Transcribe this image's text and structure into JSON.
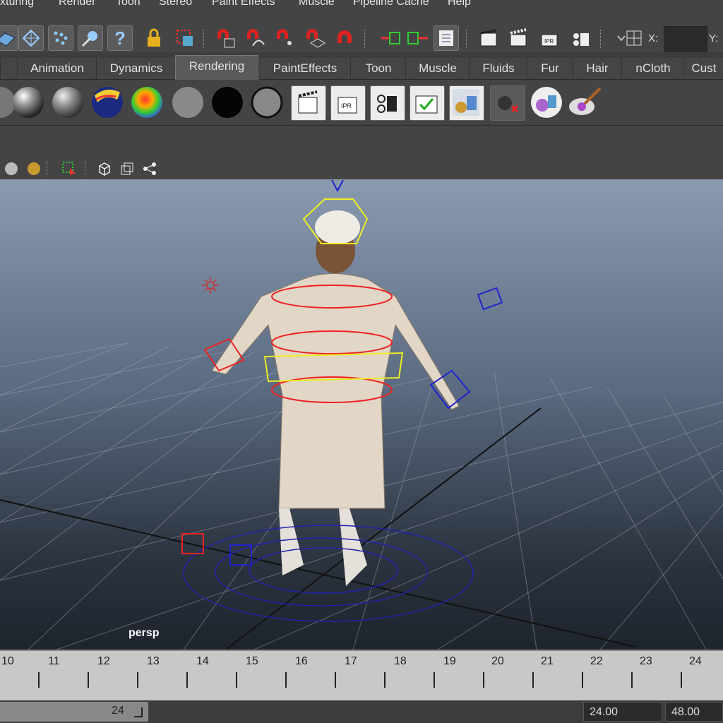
{
  "menus": [
    "xturing",
    "Render",
    "Toon",
    "Stereo",
    "Paint Effects",
    "Muscle",
    "Pipeline Cache",
    "Help"
  ],
  "status": {
    "x_label": "X:",
    "x_value": "",
    "y_label": "Y:",
    "icons": [
      "vertex-mode-icon",
      "mesh-select-icon",
      "particle-icon",
      "magnet-tool-icon",
      "help-icon",
      "lock-icon",
      "select-region-icon",
      "snap-grid-icon",
      "snap-curve-icon",
      "snap-point-icon",
      "snap-plane-icon",
      "snap-live-icon",
      "input-ops-icon",
      "output-ops-icon",
      "attribute-editor-icon",
      "render-view-icon",
      "render-current-icon",
      "ipr-render-icon",
      "render-settings-icon"
    ]
  },
  "shelf_tabs": [
    "",
    "Animation",
    "Dynamics",
    "Rendering",
    "PaintEffects",
    "Toon",
    "Muscle",
    "Fluids",
    "Fur",
    "Hair",
    "nCloth",
    "Cust"
  ],
  "active_tab": "Rendering",
  "shelf_icons": [
    "partial-sphere-icon",
    "phong-sphere-icon",
    "blinn-sphere-icon",
    "ramp-sphere-icon",
    "rainbow-sphere-icon",
    "lambert-grey-icon",
    "black-surface-icon",
    "grey-surface-icon",
    "render-icon",
    "ipr-icon",
    "render-settings-shelf-icon",
    "batch-render-icon",
    "hypershade-icon",
    "light-linking-icon",
    "shader-ball-icon",
    "paint-brush-icon"
  ],
  "viewport": {
    "camera_label": "persp",
    "toolbar_icons": [
      "shaded-sphere-icon",
      "textured-sphere-icon",
      "select-tool-icon",
      "wireframe-cube-icon",
      "isolate-icon",
      "component-icon"
    ]
  },
  "timeline": {
    "frames": [
      "10",
      "11",
      "12",
      "13",
      "14",
      "15",
      "16",
      "17",
      "18",
      "19",
      "20",
      "21",
      "22",
      "23",
      "24"
    ]
  },
  "range": {
    "current_end": "24",
    "end_time": "24.00",
    "playback_end": "48.00"
  }
}
